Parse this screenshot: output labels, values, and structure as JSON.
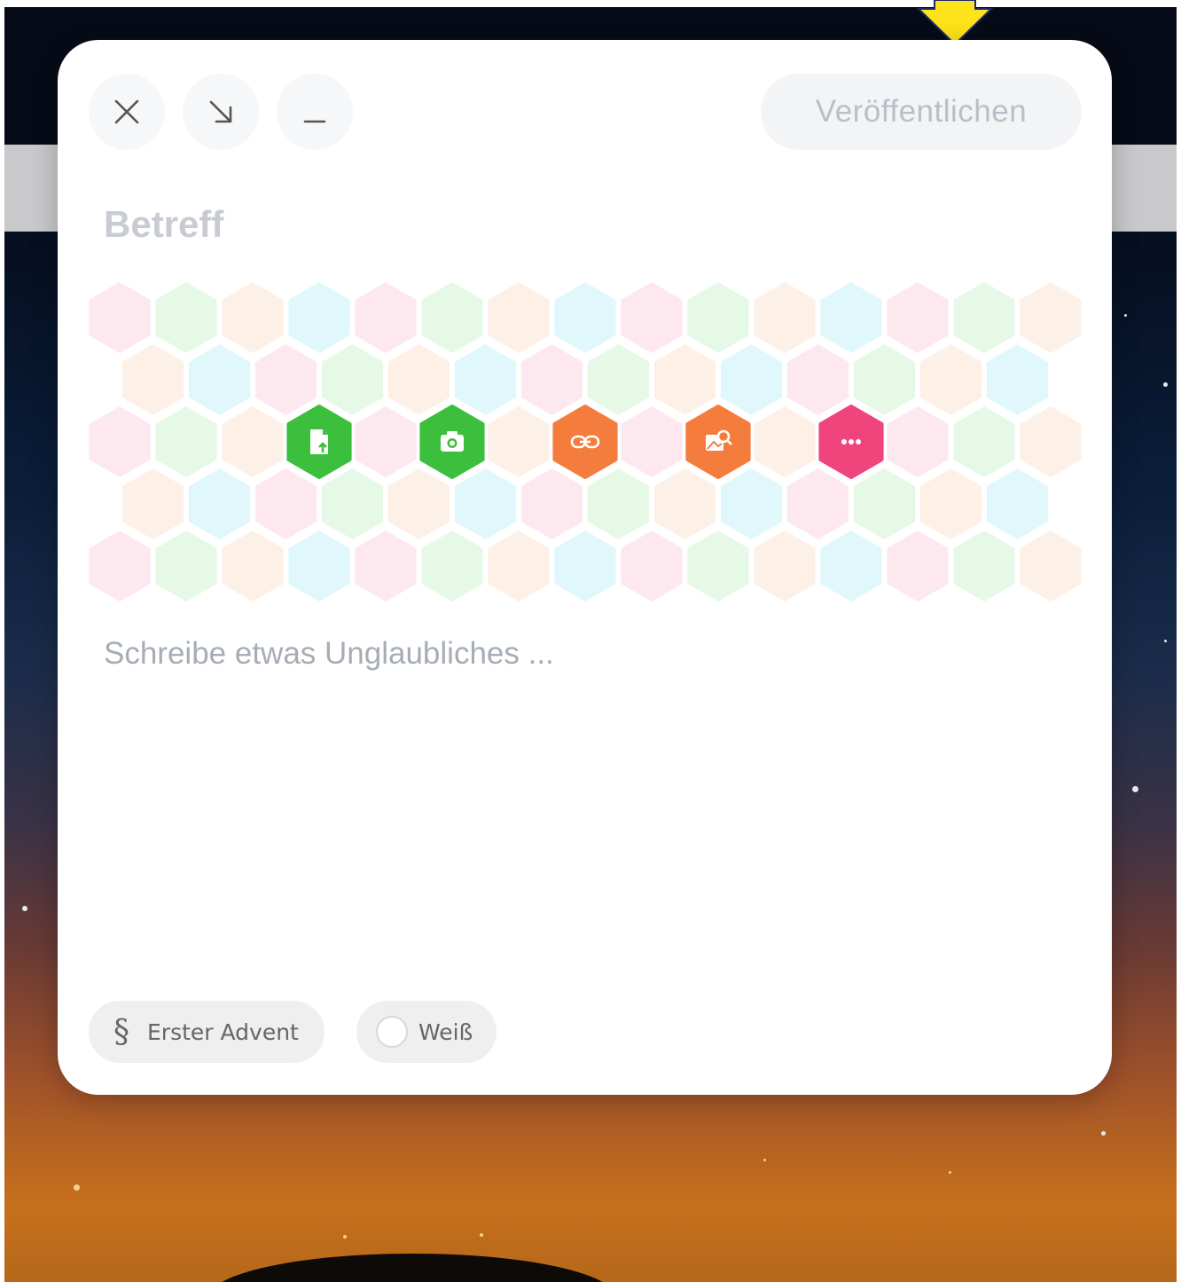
{
  "header": {
    "close_icon": "close-icon",
    "collapse_icon": "arrow-down-right-icon",
    "minimize_icon": "minimize-icon",
    "publish_label": "Veröffentlichen"
  },
  "editor": {
    "subject_placeholder": "Betreff",
    "body_placeholder": "Schreibe etwas Unglaubliches ..."
  },
  "attachments": [
    {
      "name": "file-upload-icon",
      "color": "#3cbf3c"
    },
    {
      "name": "camera-icon",
      "color": "#3cbf3c"
    },
    {
      "name": "link-icon",
      "color": "#f47c3c"
    },
    {
      "name": "image-search-icon",
      "color": "#f47c3c"
    },
    {
      "name": "more-icon",
      "color": "#f0457c"
    }
  ],
  "footer": {
    "topic_label": "Erster Advent",
    "topic_symbol": "§",
    "color_label": "Weiß"
  },
  "colors": {
    "hex_pink": "#fde8ef",
    "hex_green": "#e6f8e6",
    "hex_peach": "#fdf0e6",
    "hex_cyan": "#e0f8fb",
    "marker": "#ffe31a"
  }
}
